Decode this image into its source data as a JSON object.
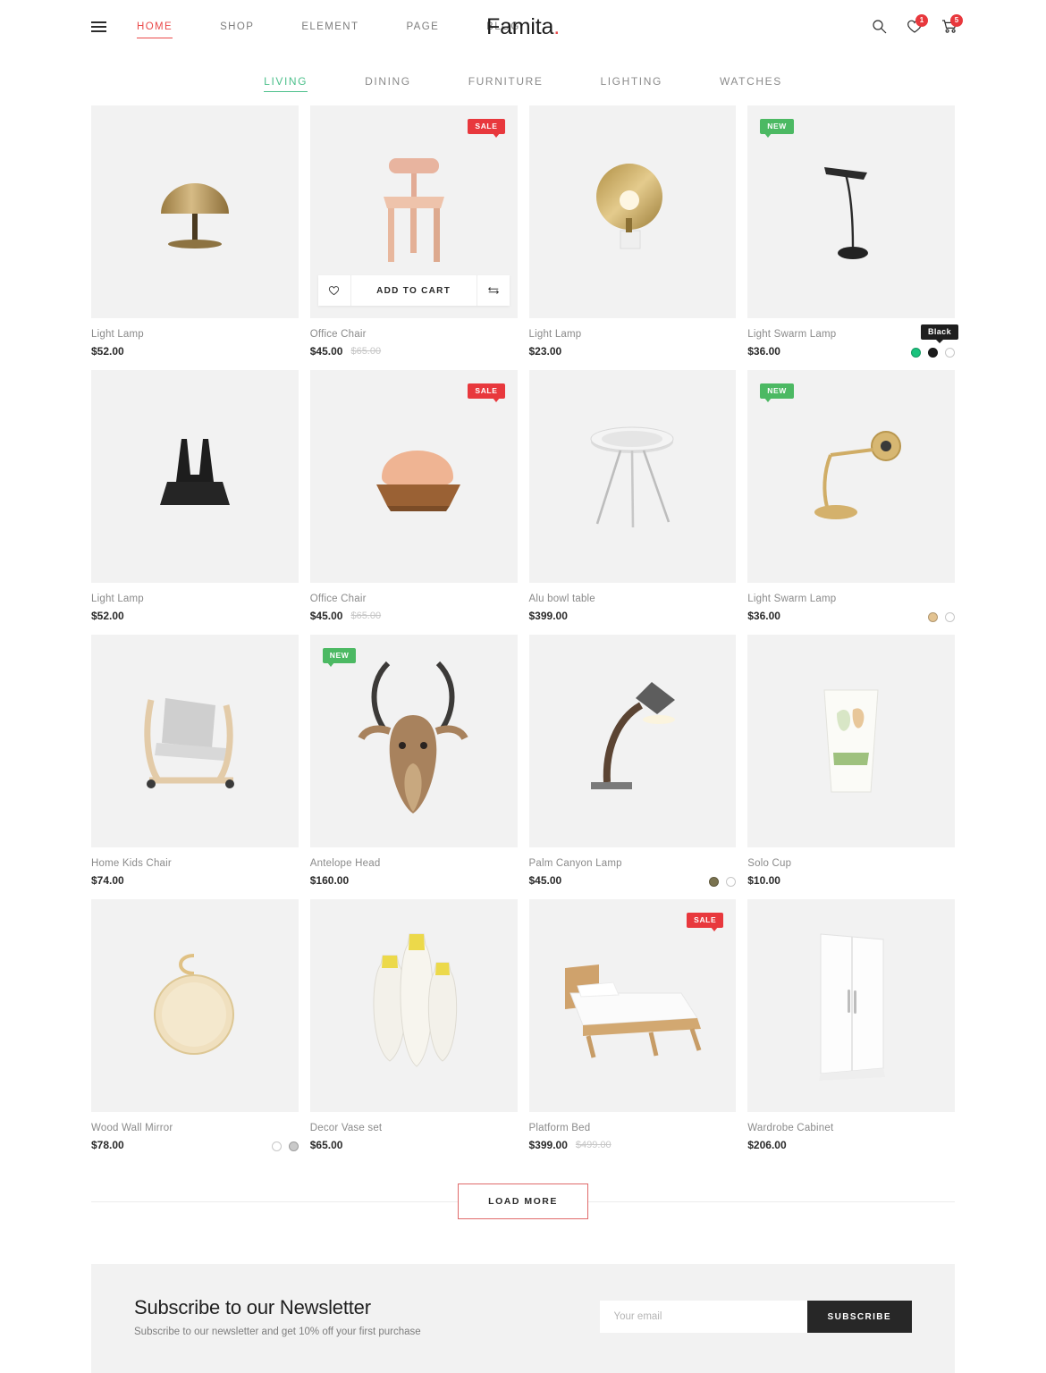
{
  "header": {
    "menu_icon": "hamburger-icon",
    "nav": [
      {
        "label": "HOME",
        "active": true
      },
      {
        "label": "SHOP",
        "active": false
      },
      {
        "label": "ELEMENT",
        "active": false
      },
      {
        "label": "PAGE",
        "active": false
      },
      {
        "label": "BLOG",
        "active": false
      }
    ],
    "logo": "Famita",
    "logo_dot": ".",
    "icons": {
      "search": "search-icon",
      "wishlist": "heart-icon",
      "cart": "cart-icon"
    },
    "wishlist_count": "1",
    "cart_count": "5",
    "accent_red": "#ea4a4a"
  },
  "categories": {
    "active_color": "#4ec08c",
    "tabs": [
      {
        "label": "LIVING",
        "active": true
      },
      {
        "label": "DINING",
        "active": false
      },
      {
        "label": "FURNITURE",
        "active": false
      },
      {
        "label": "LIGHTING",
        "active": false
      },
      {
        "label": "WATCHES",
        "active": false
      }
    ]
  },
  "hover_actions": {
    "wishlist_icon": "heart-icon",
    "add_to_cart": "ADD TO CART",
    "compare_icon": "compare-arrows-icon"
  },
  "badges": {
    "sale": "SALE",
    "new": "NEW",
    "sale_color": "#e8383d",
    "new_color": "#4cb963"
  },
  "products": [
    {
      "name": "Light Lamp",
      "price": "$52.00",
      "old_price": "",
      "flag": "",
      "art": "dome-lamp",
      "swatches": [],
      "tooltip": "",
      "hover": false
    },
    {
      "name": "Office Chair",
      "price": "$45.00",
      "old_price": "$65.00",
      "flag": "sale",
      "art": "stool-chair",
      "swatches": [],
      "tooltip": "",
      "hover": true
    },
    {
      "name": "Light Lamp",
      "price": "$23.00",
      "old_price": "",
      "flag": "",
      "art": "disc-lamp",
      "swatches": [],
      "tooltip": "",
      "hover": false
    },
    {
      "name": "Light Swarm Lamp",
      "price": "$36.00",
      "old_price": "",
      "flag": "new",
      "art": "thin-desk-lamp",
      "swatches": [
        "#19c37d",
        "#1c1c1c",
        "#ffffff"
      ],
      "tooltip": "Black",
      "hover": false
    },
    {
      "name": "Light Lamp",
      "price": "$52.00",
      "old_price": "",
      "flag": "",
      "art": "black-sculpture",
      "swatches": [],
      "tooltip": "",
      "hover": false
    },
    {
      "name": "Office Chair",
      "price": "$45.00",
      "old_price": "$65.00",
      "flag": "sale",
      "art": "lounge-chair",
      "swatches": [],
      "tooltip": "",
      "hover": false
    },
    {
      "name": "Alu bowl table",
      "price": "$399.00",
      "old_price": "",
      "flag": "",
      "art": "tripod-table",
      "swatches": [],
      "tooltip": "",
      "hover": false
    },
    {
      "name": "Light Swarm Lamp",
      "price": "$36.00",
      "old_price": "",
      "flag": "new",
      "art": "brass-task-lamp",
      "swatches": [
        "#e3c391",
        "#ffffff"
      ],
      "tooltip": "",
      "hover": false
    },
    {
      "name": "Home Kids Chair",
      "price": "$74.00",
      "old_price": "",
      "flag": "",
      "art": "kids-rocker",
      "swatches": [],
      "tooltip": "",
      "hover": false
    },
    {
      "name": "Antelope Head",
      "price": "$160.00",
      "old_price": "",
      "flag": "new",
      "art": "antelope-head",
      "swatches": [],
      "tooltip": "",
      "hover": false
    },
    {
      "name": "Palm Canyon Lamp",
      "price": "$45.00",
      "old_price": "",
      "flag": "",
      "art": "curved-lamp",
      "swatches": [
        "#7a7350",
        "#ffffff"
      ],
      "tooltip": "",
      "hover": false,
      "swatch_left": true
    },
    {
      "name": "Solo Cup",
      "price": "$10.00",
      "old_price": "",
      "flag": "",
      "art": "paper-cup",
      "swatches": [],
      "tooltip": "",
      "hover": false
    },
    {
      "name": "Wood Wall Mirror",
      "price": "$78.00",
      "old_price": "",
      "flag": "",
      "art": "round-mirror",
      "swatches": [
        "#ffffff",
        "#c9c9c9"
      ],
      "tooltip": "",
      "hover": false,
      "swatch_left": true
    },
    {
      "name": "Decor Vase set",
      "price": "$65.00",
      "old_price": "",
      "flag": "",
      "art": "vase-set",
      "swatches": [],
      "tooltip": "",
      "hover": false
    },
    {
      "name": "Platform Bed",
      "price": "$399.00",
      "old_price": "$499.00",
      "flag": "sale",
      "art": "platform-bed",
      "swatches": [],
      "tooltip": "",
      "hover": false
    },
    {
      "name": "Wardrobe Cabinet",
      "price": "$206.00",
      "old_price": "",
      "flag": "",
      "art": "wardrobe",
      "swatches": [],
      "tooltip": "",
      "hover": false
    }
  ],
  "load_more": {
    "label": "LOAD MORE",
    "border_color": "#e06a6a"
  },
  "newsletter": {
    "title": "Subscribe to our Newsletter",
    "subtitle": "Subscribe to our newsletter and get 10% off your first purchase",
    "placeholder": "Your email",
    "value": "",
    "button": "SUBSCRIBE"
  }
}
